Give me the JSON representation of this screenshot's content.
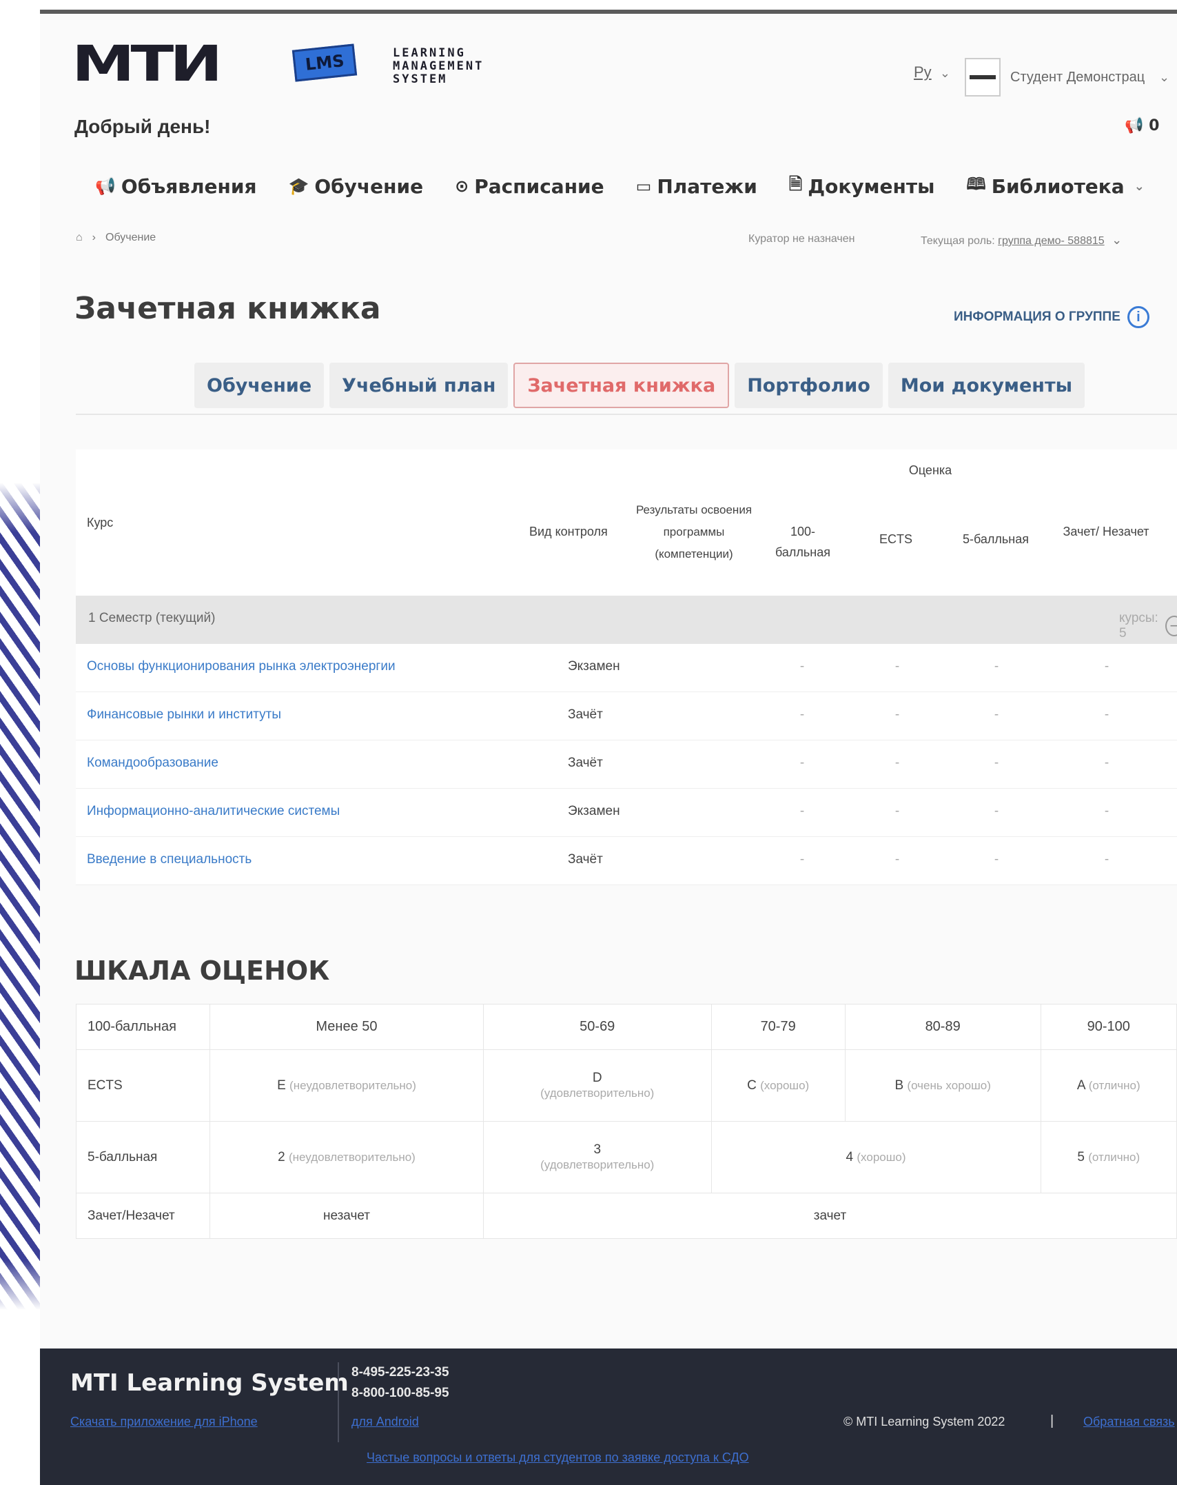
{
  "header": {
    "logo_mark": "МТИ",
    "logo_badge": "LMS",
    "logo_text_1": "LEARNING",
    "logo_text_2": "MANAGEMENT",
    "logo_text_3": "SYSTEM",
    "language": "Ру",
    "user_name": "Студент Демонстрац",
    "greeting": "Добрый день!",
    "notif_count": "0"
  },
  "nav": [
    {
      "icon": "megaphone-icon",
      "glyph": "📢",
      "label": "Объявления"
    },
    {
      "icon": "graduation-cap-icon",
      "glyph": "🎓",
      "label": "Обучение"
    },
    {
      "icon": "clock-icon",
      "glyph": "⊙",
      "label": "Расписание"
    },
    {
      "icon": "payments-icon",
      "glyph": "▭",
      "label": "Платежи"
    },
    {
      "icon": "document-icon",
      "glyph": "🗎",
      "label": "Документы"
    },
    {
      "icon": "book-icon",
      "glyph": "🕮",
      "label": "Библиотека"
    }
  ],
  "breadcrumb": {
    "current": "Обучение"
  },
  "curator": "Куратор не назначен",
  "role": {
    "label": "Текущая роль:",
    "value": "группа демо- 588815"
  },
  "page_title": "Зачетная книжка",
  "group_info": "ИНФОРМАЦИЯ О ГРУППЕ",
  "tabs": [
    "Обучение",
    "Учебный план",
    "Зачетная книжка",
    "Портфолио",
    "Мои документы"
  ],
  "grades_table": {
    "headers": {
      "course": "Курс",
      "control": "Вид контроля",
      "results": "Результаты освоения программы (компетенции)",
      "grade": "Оценка",
      "g100": "100-балльная",
      "ects": "ECTS",
      "g5": "5-балльная",
      "pass": "Зачет/ Незачет"
    },
    "semester": {
      "label": "1   Семестр (текущий)",
      "courses": "курсы: 5"
    },
    "rows": [
      {
        "course": "Основы функционирования рынка электроэнергии",
        "control": "Экзамен",
        "g100": "-",
        "ects": "-",
        "g5": "-",
        "pass": "-"
      },
      {
        "course": "Финансовые рынки и институты",
        "control": "Зачёт",
        "g100": "-",
        "ects": "-",
        "g5": "-",
        "pass": "-"
      },
      {
        "course": "Командообразование",
        "control": "Зачёт",
        "g100": "-",
        "ects": "-",
        "g5": "-",
        "pass": "-"
      },
      {
        "course": "Информационно-аналитические системы",
        "control": "Экзамен",
        "g100": "-",
        "ects": "-",
        "g5": "-",
        "pass": "-"
      },
      {
        "course": "Введение в специальность",
        "control": "Зачёт",
        "g100": "-",
        "ects": "-",
        "g5": "-",
        "pass": "-"
      }
    ]
  },
  "scale": {
    "title": "ШКАЛА ОЦЕНОК",
    "row100": {
      "label": "100-балльная",
      "cells": [
        "Менее 50",
        "50-69",
        "70-79",
        "80-89",
        "90-100"
      ]
    },
    "rowEcts": {
      "label": "ECTS",
      "cells": [
        {
          "main": "E",
          "sub": "(неудовлетворительно)"
        },
        {
          "main": "D",
          "sub": "(удовлетворительно)"
        },
        {
          "main": "C",
          "sub": "(хорошо)"
        },
        {
          "main": "B",
          "sub": "(очень хорошо)"
        },
        {
          "main": "A",
          "sub": "(отлично)"
        }
      ]
    },
    "row5": {
      "label": "5-балльная",
      "cells": [
        {
          "main": "2",
          "sub": "(неудовлетворительно)"
        },
        {
          "main": "3",
          "sub": "(удовлетворительно)"
        },
        {
          "main": "4",
          "sub": "(хорошо)"
        },
        {
          "main": "5",
          "sub": "(отлично)"
        }
      ]
    },
    "rowPass": {
      "label": "Зачет/Незачет",
      "cells": [
        "незачет",
        "зачет"
      ]
    }
  },
  "footer": {
    "brand": "MTI Learning System",
    "phone1": "8-495-225-23-35",
    "phone2": "8-800-100-85-95",
    "link_iphone": "Скачать приложение для iPhone",
    "link_android": "для Android",
    "copyright": "© MTI Learning System 2022",
    "separator": "|",
    "feedback": "Обратная связь",
    "faq": "Частые вопросы и ответы для студентов по заявке доступа к СДО"
  }
}
